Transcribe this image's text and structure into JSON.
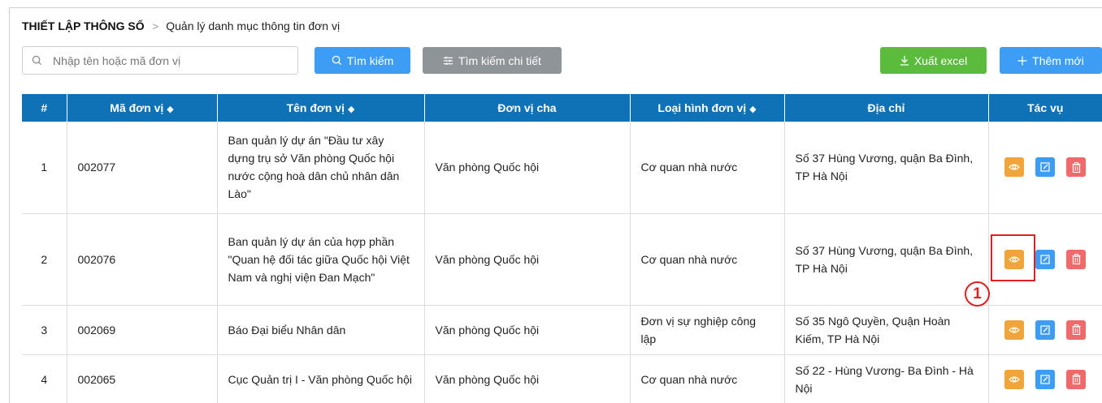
{
  "breadcrumb": {
    "root": "THIẾT LẬP THÔNG SỐ",
    "separator": ">",
    "current": "Quản lý danh mục thông tin đơn vị"
  },
  "search": {
    "placeholder": "Nhập tên hoặc mã đơn vị",
    "value": ""
  },
  "toolbar": {
    "search_label": "Tìm kiếm",
    "detail_search_label": "Tìm kiếm chi tiết",
    "export_label": "Xuất excel",
    "add_label": "Thêm mới"
  },
  "table": {
    "columns": [
      "#",
      "Mã đơn vị",
      "Tên đơn vị",
      "Đơn vị cha",
      "Loại hình đơn vị",
      "Địa chỉ",
      "Tác vụ"
    ],
    "rows": [
      {
        "index": "1",
        "code": "002077",
        "name": "Ban quản lý dự án \"Đầu tư xây dựng trụ sở Văn phòng Quốc hội nước cộng hoà dân chủ nhân dân Lào\"",
        "parent": "Văn phòng Quốc hội",
        "type": "Cơ quan nhà nước",
        "address": "Số 37 Hùng Vương, quận Ba Đình, TP Hà Nội"
      },
      {
        "index": "2",
        "code": "002076",
        "name": "Ban quản lý dự án của hợp phần \"Quan hệ đối tác giữa Quốc hội Việt Nam và nghị viện Đan Mạch\"",
        "parent": "Văn phòng Quốc hội",
        "type": "Cơ quan nhà nước",
        "address": "Số 37 Hùng Vương, quận Ba Đình, TP Hà Nội"
      },
      {
        "index": "3",
        "code": "002069",
        "name": "Báo Đại biểu Nhân dân",
        "parent": "Văn phòng Quốc hội",
        "type": "Đơn vị sự nghiệp công lập",
        "address": "Số 35 Ngô Quyền, Quận Hoàn Kiếm, TP Hà Nội"
      },
      {
        "index": "4",
        "code": "002065",
        "name": "Cục Quản trị I - Văn phòng Quốc hội",
        "parent": "Văn phòng Quốc hội",
        "type": "Cơ quan nhà nước",
        "address": "Số 22 - Hùng Vương- Ba Đình - Hà Nội"
      }
    ]
  },
  "annotation": {
    "callout_number": "1"
  },
  "icons": {
    "search": "search-icon",
    "filter": "filter-icon",
    "download": "download-icon",
    "plus": "plus-icon",
    "view": "eye-icon",
    "edit": "edit-icon",
    "delete": "trash-icon",
    "sort": "sort-icon"
  },
  "colors": {
    "header_bg": "#0f72b7",
    "primary": "#3d9df5",
    "secondary": "#8f9499",
    "success": "#5bbb3c",
    "view": "#f0a53a",
    "danger": "#ef6a6a",
    "highlight": "#e01f1f"
  }
}
